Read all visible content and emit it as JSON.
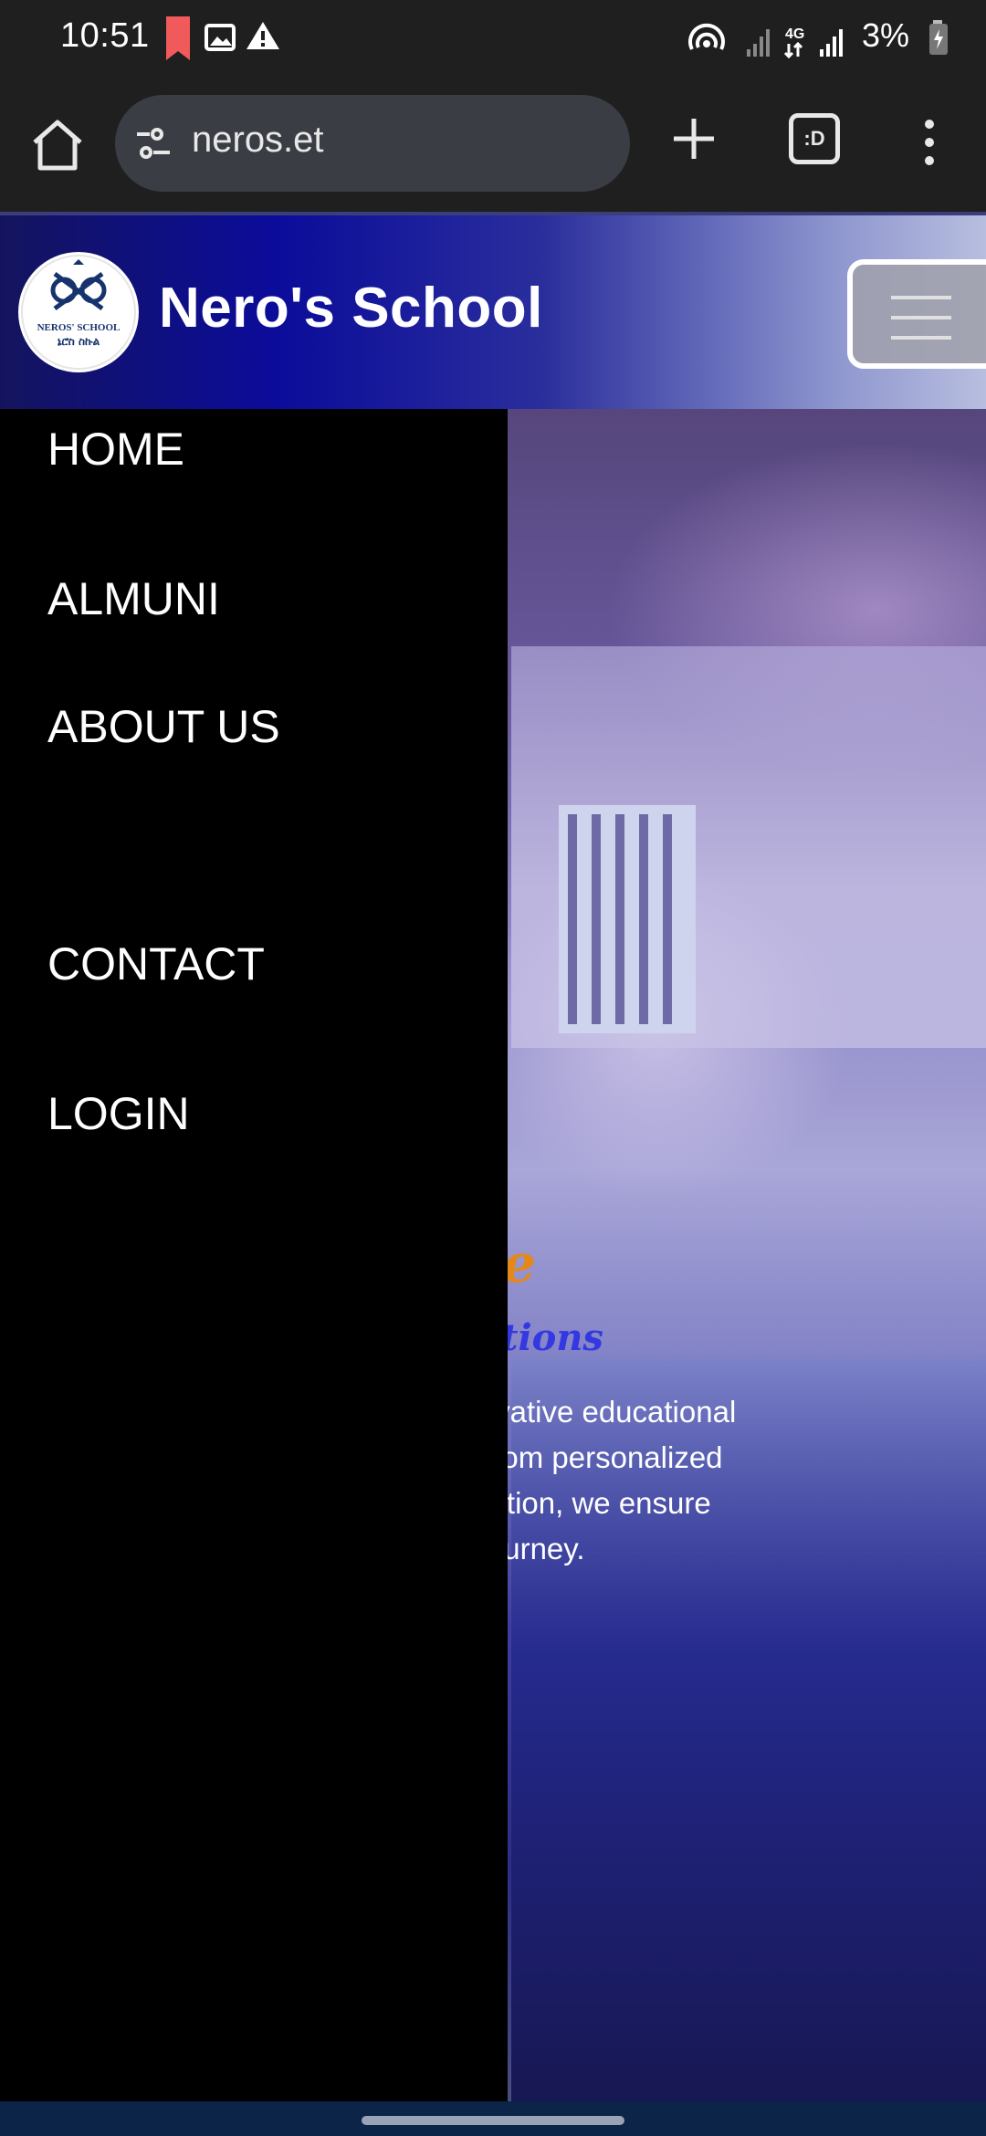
{
  "status_bar": {
    "time": "10:51",
    "battery": "3%",
    "network": "4G",
    "icons": [
      "bookmark-notification-icon",
      "image-notification-icon",
      "warning-icon",
      "hotspot-icon",
      "signal-icon",
      "battery-charging-icon"
    ]
  },
  "browser": {
    "url": "neros.et",
    "tabs_count": ":D",
    "icons": [
      "home-icon",
      "site-settings-icon",
      "new-tab-icon",
      "tab-switcher-icon",
      "more-menu-icon"
    ]
  },
  "site": {
    "title": "Nero's School",
    "logo_text": "NEROS' SCHOOL",
    "logo_subtext": "ኔሮስ ስኩል"
  },
  "nav_menu": {
    "items": [
      "HOME",
      "ALMUNI",
      "ABOUT US",
      "CONTACT",
      "LOGIN"
    ]
  },
  "hero": {
    "heading_visible": "ative",
    "subheading_visible": "l Solutions",
    "description_lines": [
      "vide innovative educational",
      "needs. From personalized",
      "gy integration, we ensure",
      "ademic journey."
    ]
  },
  "colors": {
    "header_gradient_start": "#14145e",
    "header_gradient_end": "#b8bedf",
    "heading_orange": "#e3891a",
    "subheading_blue": "#3338e0",
    "drawer_bg": "#000000"
  }
}
